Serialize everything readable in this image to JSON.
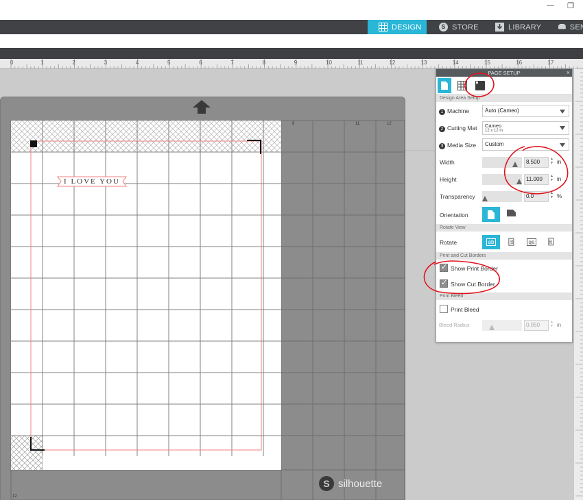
{
  "window": {
    "minimize": "—",
    "restore": "❐"
  },
  "nav": {
    "tabs": [
      {
        "label": "DESIGN",
        "icon": "grid-icon",
        "active": true
      },
      {
        "label": "STORE",
        "icon": "silhouette-s-icon",
        "active": false
      },
      {
        "label": "LIBRARY",
        "icon": "download-icon",
        "active": false
      },
      {
        "label": "SEN",
        "icon": "cutter-icon",
        "active": false
      }
    ]
  },
  "ruler": {
    "marks": [
      "0",
      "1",
      "2",
      "3",
      "4",
      "5",
      "6",
      "7",
      "8",
      "9",
      "10",
      "11",
      "12",
      "13",
      "14",
      "15",
      "16",
      "17"
    ]
  },
  "canvas": {
    "banner_text": "I LOVE YOU",
    "logo_text": "silhouette",
    "logo_mark": "S",
    "mat_col_numbers": [
      "9",
      "11",
      "12"
    ],
    "mat_row_number": "12"
  },
  "panel": {
    "title": "PAGE SETUP",
    "close": "×",
    "sections": {
      "design_area": "Design Area Setup",
      "rotate_view": "Rotate View",
      "print_cut": "Print and Cut Borders",
      "print_bleed": "Print Bleed"
    },
    "machine": {
      "step": "1",
      "label": "Machine",
      "value": "Auto (Cameo)"
    },
    "cutting_mat": {
      "step": "2",
      "label": "Cutting Mat",
      "value": "Cameo",
      "sub": "12 x 12 in"
    },
    "media_size": {
      "step": "3",
      "label": "Media Size",
      "value": "Custom"
    },
    "width": {
      "label": "Width",
      "value": "8.500",
      "unit": "in"
    },
    "height": {
      "label": "Height",
      "value": "11.000",
      "unit": "in"
    },
    "transparency": {
      "label": "Transparency",
      "value": "0.0",
      "unit": "%"
    },
    "orientation": {
      "label": "Orientation"
    },
    "rotate": {
      "label": "Rotate",
      "buttons": [
        "ab",
        "ab",
        "qe",
        "ab"
      ]
    },
    "show_print_border": {
      "label": "Show Print Border",
      "checked": true
    },
    "show_cut_border": {
      "label": "Show Cut Border",
      "checked": true
    },
    "print_bleed": {
      "label": "Print Bleed",
      "checked": false
    },
    "bleed_radius": {
      "label": "Bleed Radius",
      "value": "0.050",
      "unit": "in"
    }
  },
  "colors": {
    "accent": "#29b6d7",
    "annotation": "#e0141e",
    "print_border": "#f08080"
  }
}
